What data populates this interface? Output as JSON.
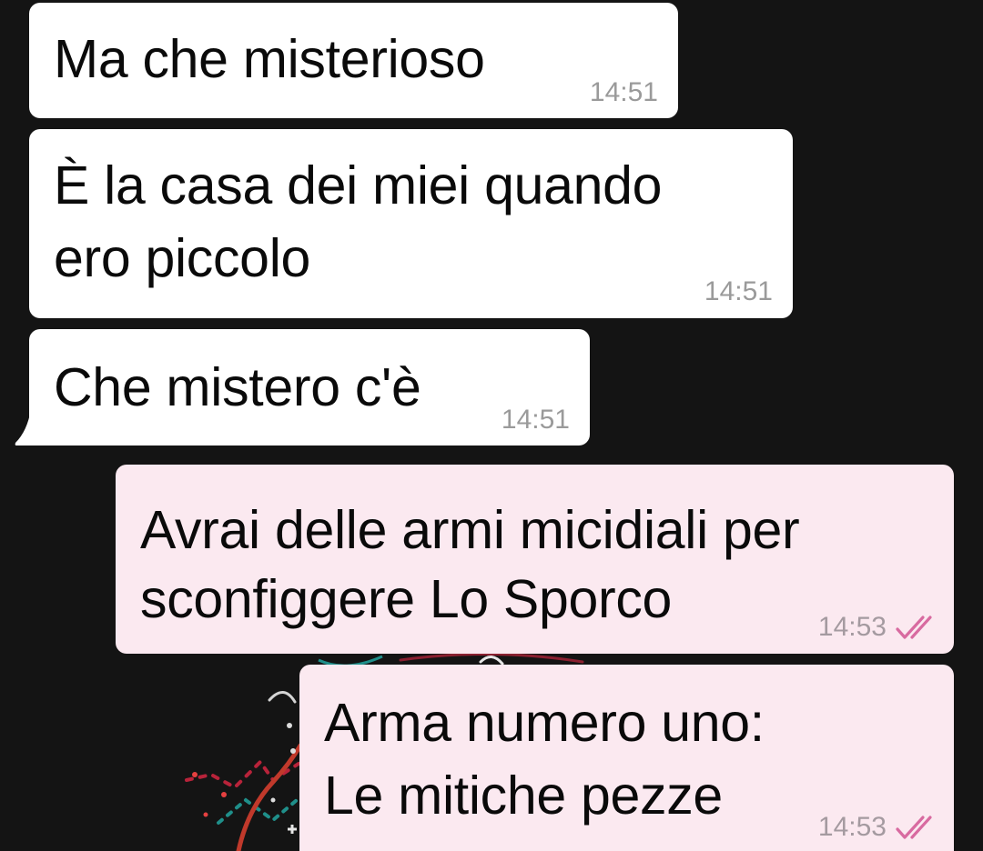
{
  "messages": [
    {
      "direction": "in",
      "text": "Ma che misterioso",
      "time": "14:51"
    },
    {
      "direction": "in",
      "text": "È la casa dei miei quando",
      "text2": "ero piccolo",
      "time": "14:51"
    },
    {
      "direction": "in",
      "text": "Che mistero c'è",
      "time": "14:51"
    },
    {
      "direction": "out",
      "text": "Avrai delle armi micidiali per",
      "text2": "sconfiggere Lo Sporco",
      "time": "14:53",
      "status_icon": "double-check-icon"
    },
    {
      "direction": "out",
      "text": "Arma numero uno:",
      "text2": "Le mitiche pezze",
      "time": "14:53",
      "status_icon": "double-check-icon"
    }
  ],
  "colors": {
    "background": "#141414",
    "incoming_bubble": "#ffffff",
    "outgoing_bubble": "#fbe9f0",
    "read_tick": "#d86aa0",
    "timestamp": "#9a9a9a"
  }
}
